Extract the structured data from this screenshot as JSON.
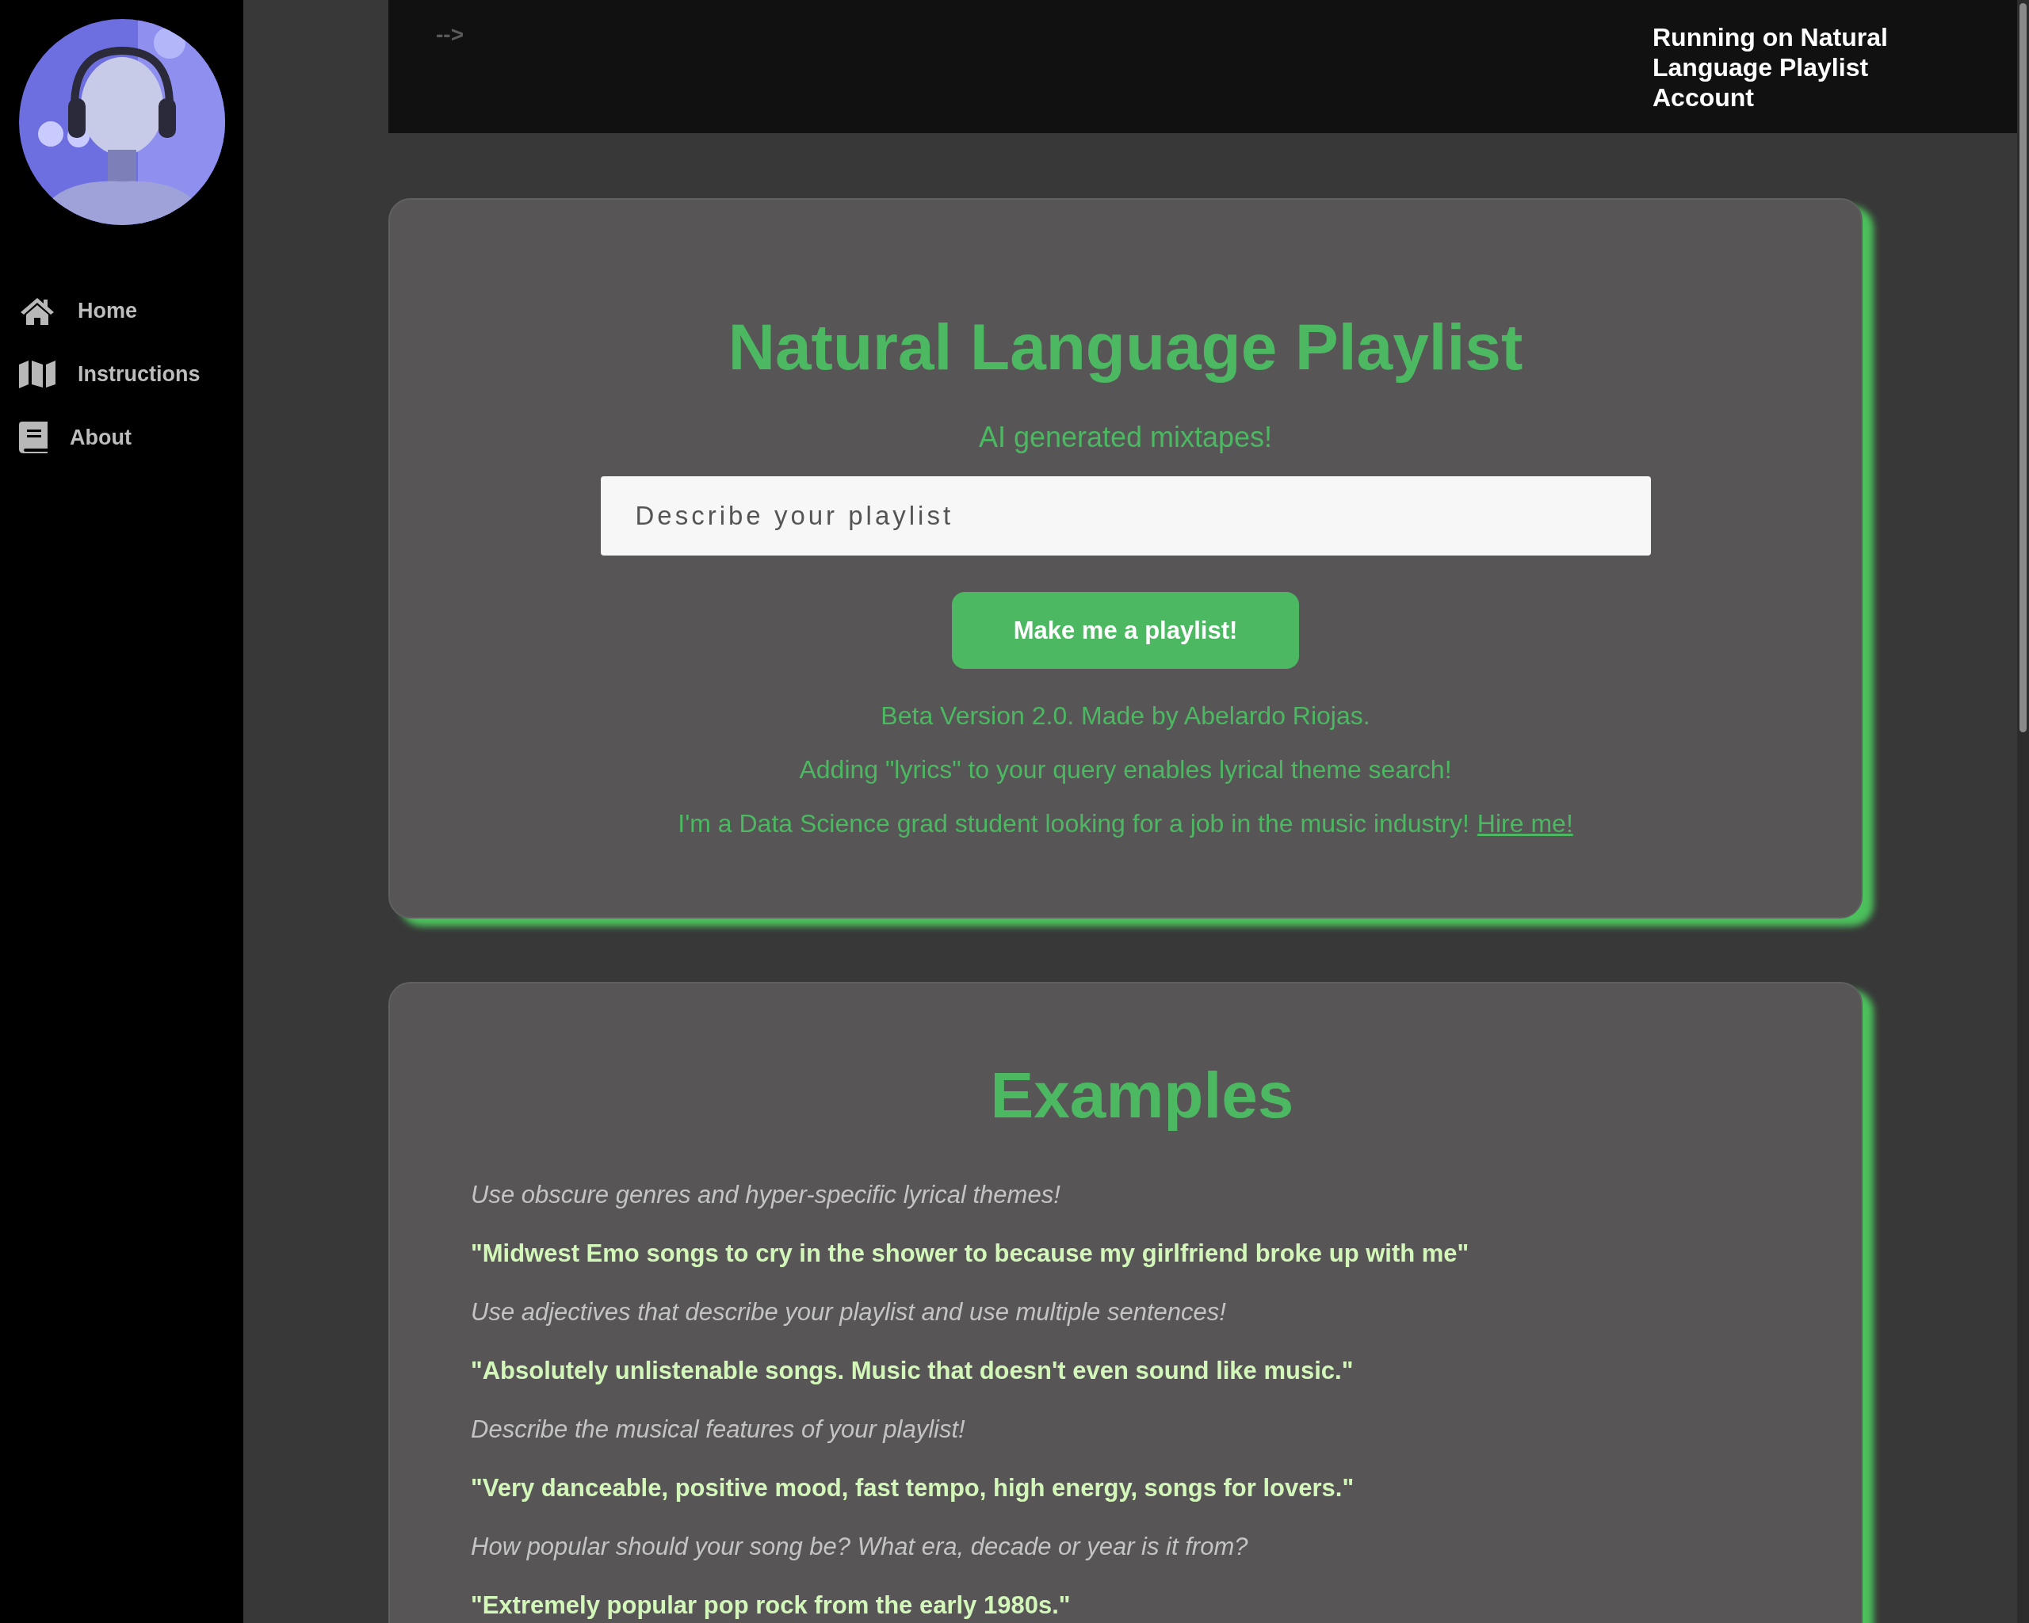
{
  "sidebar": {
    "items": [
      {
        "label": "Home",
        "kind": "home"
      },
      {
        "label": "Instructions",
        "kind": "map"
      },
      {
        "label": "About",
        "kind": "book"
      }
    ]
  },
  "header": {
    "comment_text": "-->",
    "account_text": "Running on Natural Language Playlist Account"
  },
  "generator": {
    "title": "Natural Language Playlist",
    "subtitle": "AI generated mixtapes!",
    "input": {
      "placeholder": "Describe your playlist"
    },
    "button": "Make me a playlist!",
    "notes": [
      {
        "text": "Beta Version 2.0. Made by Abelardo Riojas."
      },
      {
        "text": "Adding \"lyrics\" to your query enables lyrical theme search!"
      },
      {
        "text": "I'm a Data Science grad student looking for a job in the music industry!",
        "link": "Hire me!"
      }
    ]
  },
  "examples": {
    "title": "Examples",
    "items": [
      {
        "kind": "tip",
        "text": "Use obscure genres and hyper-specific lyrical themes!"
      },
      {
        "kind": "example",
        "text": "\"Midwest Emo songs to cry in the shower to because my girlfriend broke up with me\""
      },
      {
        "kind": "tip",
        "text": "Use adjectives that describe your playlist and use multiple sentences!"
      },
      {
        "kind": "example",
        "text": "\"Absolutely unlistenable songs. Music that doesn't even sound like music.\""
      },
      {
        "kind": "tip",
        "text": "Describe the musical features of your playlist!"
      },
      {
        "kind": "example",
        "text": "\"Very danceable, positive mood, fast tempo, high energy, songs for lovers.\""
      },
      {
        "kind": "tip",
        "text": "How popular should your song be? What era, decade or year is it from?"
      },
      {
        "kind": "example",
        "text": "\"Extremely popular pop rock from the early 1980s.\""
      }
    ]
  }
}
